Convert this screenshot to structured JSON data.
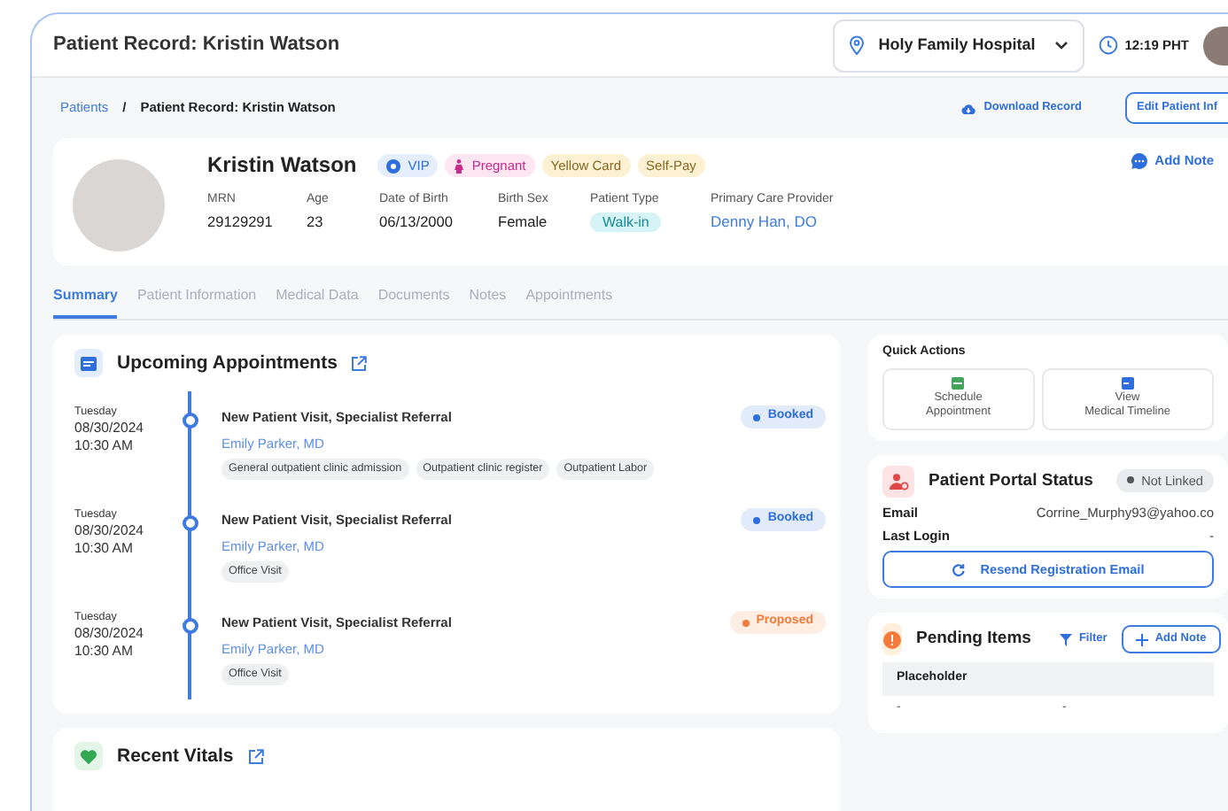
{
  "header": {
    "title": "Patient Record: Kristin Watson",
    "location": "Holy Family Hospital",
    "time": "12:19 PHT"
  },
  "breadcrumb_separator": "/",
  "breadcrumb": [
    {
      "label": "Patients",
      "kind": "link"
    },
    {
      "label": "Patient Record: Kristin Watson",
      "kind": "current"
    }
  ],
  "record_actions": {
    "download": "Download Record",
    "edit": "Edit Patient Inf"
  },
  "patient": {
    "name": "Kristin Watson",
    "add_note": "Add Note",
    "tags": [
      {
        "label": "VIP",
        "kind": "vip"
      },
      {
        "label": "Pregnant",
        "kind": "pregnant"
      },
      {
        "label": "Yellow Card",
        "kind": "plain"
      },
      {
        "label": "Self-Pay",
        "kind": "plain"
      }
    ],
    "fields": [
      {
        "label": "MRN",
        "value": "29129291",
        "kind": "text"
      },
      {
        "label": "Age",
        "value": "23",
        "kind": "text"
      },
      {
        "label": "Date of Birth",
        "value": "06/13/2000",
        "kind": "text"
      },
      {
        "label": "Birth Sex",
        "value": "Female",
        "kind": "text"
      },
      {
        "label": "Patient Type",
        "value": "Walk-in",
        "kind": "pill"
      },
      {
        "label": "Primary Care Provider",
        "value": "Denny Han, DO",
        "kind": "link"
      }
    ]
  },
  "tabs": [
    {
      "label": "Summary",
      "selected": true
    },
    {
      "label": "Patient Information",
      "selected": false
    },
    {
      "label": "Medical Data",
      "selected": false
    },
    {
      "label": "Documents",
      "selected": false
    },
    {
      "label": "Notes",
      "selected": false
    },
    {
      "label": "Appointments",
      "selected": false
    }
  ],
  "appointments": {
    "title": "Upcoming Appointments",
    "items": [
      {
        "day": "Tuesday",
        "date": "08/30/2024",
        "time": "10:30 AM",
        "title": "New Patient Visit, Specialist Referral",
        "provider": "Emily Parker, MD",
        "status": "Booked",
        "color": "#2f6fdd",
        "tags": [
          "General outpatient clinic admission",
          "Outpatient clinic register",
          "Outpatient Labor"
        ]
      },
      {
        "day": "Tuesday",
        "date": "08/30/2024",
        "time": "10:30 AM",
        "title": "New Patient Visit, Specialist Referral",
        "provider": "Emily Parker, MD",
        "status": "Booked",
        "color": "#2f6fdd",
        "tags": [
          "Office Visit"
        ]
      },
      {
        "day": "Tuesday",
        "date": "08/30/2024",
        "time": "10:30 AM",
        "title": "New Patient Visit, Specialist Referral",
        "provider": "Emily Parker, MD",
        "status": "Proposed",
        "color": "#f07b3a",
        "tags": [
          "Office Visit"
        ]
      }
    ]
  },
  "vitals": {
    "title": "Recent Vitals"
  },
  "quick_actions": {
    "title": "Quick Actions",
    "items": [
      {
        "lines": [
          "Schedule",
          "Appointment"
        ],
        "kind": "schedule"
      },
      {
        "lines": [
          "View",
          "Medical Timeline"
        ],
        "kind": "timeline"
      }
    ]
  },
  "portal": {
    "title": "Patient Portal Status",
    "status": "Not Linked",
    "linked": false,
    "rows": [
      {
        "label": "Email",
        "value": "Corrine_Murphy93@yahoo.co"
      },
      {
        "label": "Last Login",
        "value": "-"
      }
    ],
    "button": "Resend Registration Email"
  },
  "pending": {
    "title": "Pending Items",
    "filter": "Filter",
    "add_note": "Add Note",
    "columns": [
      "Placeholder"
    ],
    "rows": [
      [
        "-",
        "-"
      ]
    ]
  }
}
